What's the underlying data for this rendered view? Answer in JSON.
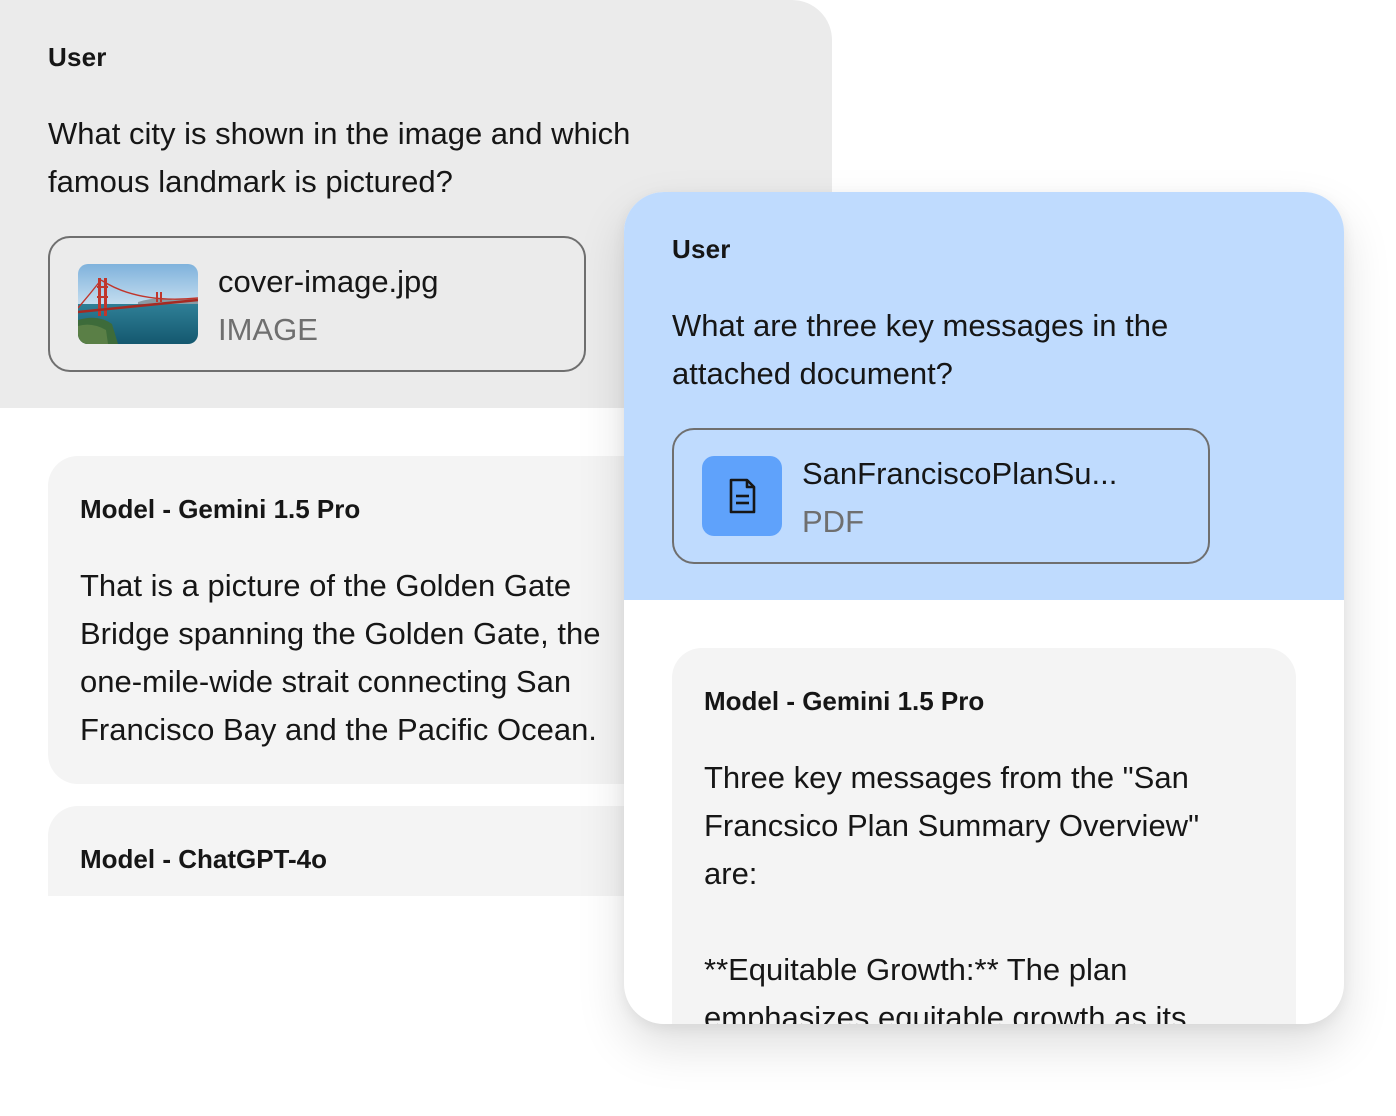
{
  "conversation_1": {
    "user": {
      "role": "User",
      "prompt": "What city is shown in the image and which famous landmark is pictured?",
      "attachment": {
        "name": "cover-image.jpg",
        "type": "IMAGE",
        "icon": "golden-gate-bridge-thumbnail"
      }
    },
    "responses": [
      {
        "label": "Model - Gemini 1.5 Pro",
        "text": "That is a picture of the Golden Gate Bridge spanning the Golden Gate, the one-mile-wide strait connecting San Francisco Bay and the Pacific Ocean."
      },
      {
        "label": "Model - ChatGPT-4o",
        "text": ""
      }
    ]
  },
  "conversation_2": {
    "user": {
      "role": "User",
      "prompt": "What are three key messages in the attached document?",
      "attachment": {
        "name": "SanFranciscoPlanSu...",
        "type": "PDF",
        "icon": "document-icon"
      }
    },
    "responses": [
      {
        "label": "Model - Gemini 1.5 Pro",
        "text_intro": "Three key messages from the \"San Francsico Plan Summary Overview\" are:",
        "text_point": "**Equitable Growth:** The plan emphasizes equitable growth as its"
      }
    ]
  },
  "colors": {
    "gray_user_bg": "#ebebeb",
    "blue_user_bg": "#bfdbfe",
    "model_card_bg": "#f4f4f4",
    "pdf_icon_bg": "#5fa2fb",
    "text_primary": "#161616",
    "text_secondary": "#6f6f6f"
  }
}
